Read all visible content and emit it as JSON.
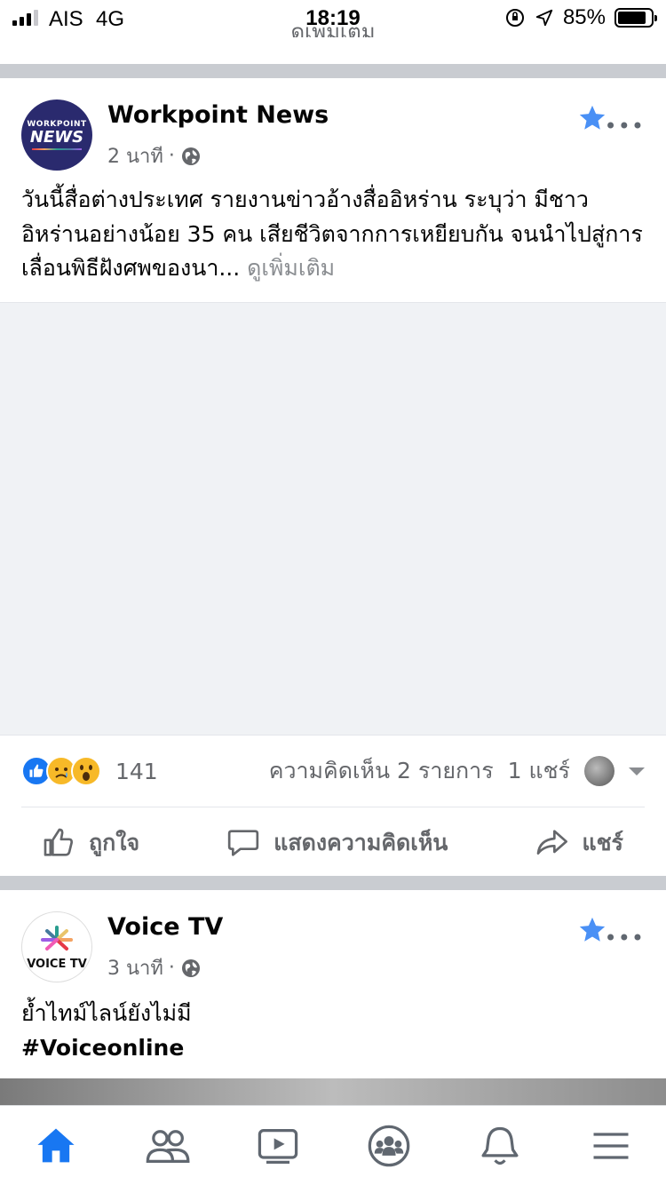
{
  "status_bar": {
    "carrier": "AIS",
    "network": "4G",
    "time": "18:19",
    "battery": "85%",
    "battery_level": 0.85
  },
  "clipped_text": "ดูเพิ่มเติม",
  "posts": [
    {
      "page_name": "Workpoint News",
      "avatar_text_small": "WORKPOINT",
      "avatar_text_big": "NEWS",
      "time": "2 นาที",
      "separator": "·",
      "text": "วันนี้สื่อต่างประเทศ รายงานข่าวอ้างสื่ออิหร่าน ระบุว่า มีชาวอิหร่านอย่างน้อย 35 คน เสียชีวิตจากการเหยียบกัน จนนำไปสู่การเลื่อนพิธีฝังศพของนา...",
      "see_more": "ดูเพิ่มเติม",
      "reaction_count": "141",
      "comments": "ความคิดเห็น 2 รายการ",
      "shares": "1 แชร์",
      "actions": {
        "like": "ถูกใจ",
        "comment": "แสดงความคิดเห็น",
        "share": "แชร์"
      }
    },
    {
      "page_name": "Voice TV",
      "avatar_text": "VOICE TV",
      "time": "3 นาที",
      "separator": "·",
      "text_line1": "ย้ำไทม์ไลน์ยังไม่มี",
      "text_line2": "#Voiceonline"
    }
  ],
  "colors": {
    "accent": "#1877f2",
    "star": "#4a90f5",
    "divider": "#c9ccd1",
    "muted_text": "#65676b"
  },
  "bottom_nav": [
    {
      "icon": "home-icon",
      "active": true
    },
    {
      "icon": "friends-icon",
      "active": false
    },
    {
      "icon": "watch-icon",
      "active": false
    },
    {
      "icon": "groups-icon",
      "active": false
    },
    {
      "icon": "notifications-icon",
      "active": false
    },
    {
      "icon": "menu-icon",
      "active": false
    }
  ]
}
